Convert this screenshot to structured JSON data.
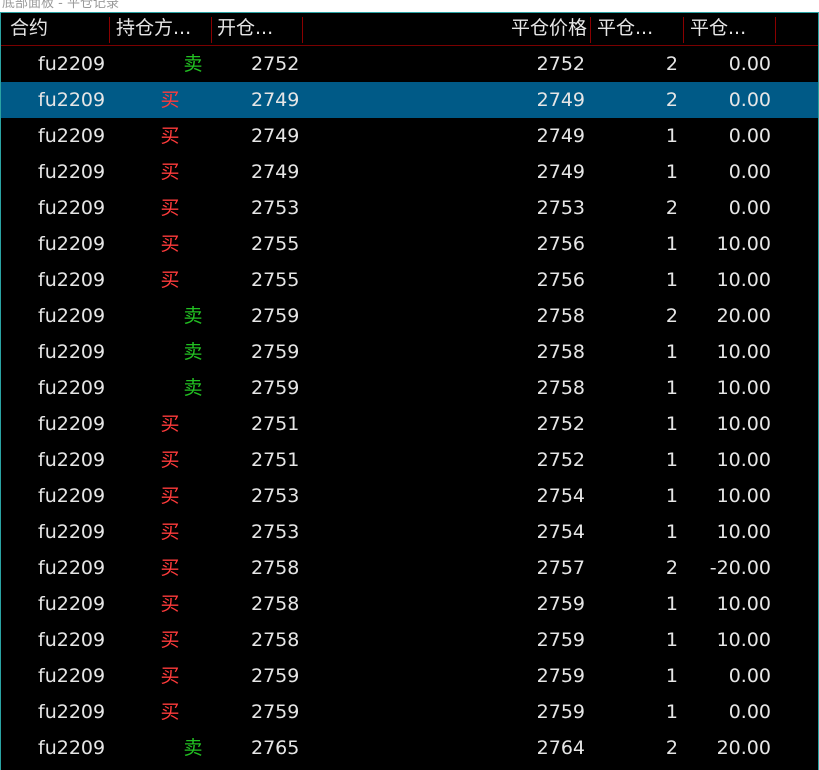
{
  "window_title": "底部面板 - 平仓记录",
  "columns": [
    {
      "key": "contract",
      "label": "合约"
    },
    {
      "key": "direction",
      "label": "持仓方..."
    },
    {
      "key": "open_price",
      "label": "开仓..."
    },
    {
      "key": "close_price",
      "label": "平仓价格"
    },
    {
      "key": "quantity",
      "label": "平仓..."
    },
    {
      "key": "pnl",
      "label": "平仓..."
    }
  ],
  "colors": {
    "buy": "#ff3b3b",
    "sell": "#22c022",
    "selected_row": "#005a87",
    "border": "#2aa3a3"
  },
  "selected_row_index": 1,
  "rows": [
    {
      "contract": "fu2209",
      "direction": "卖",
      "side": "sell",
      "open_price": "2752",
      "close_price": "2752",
      "quantity": "2",
      "pnl": "0.00"
    },
    {
      "contract": "fu2209",
      "direction": "买",
      "side": "buy",
      "open_price": "2749",
      "close_price": "2749",
      "quantity": "2",
      "pnl": "0.00"
    },
    {
      "contract": "fu2209",
      "direction": "买",
      "side": "buy",
      "open_price": "2749",
      "close_price": "2749",
      "quantity": "1",
      "pnl": "0.00"
    },
    {
      "contract": "fu2209",
      "direction": "买",
      "side": "buy",
      "open_price": "2749",
      "close_price": "2749",
      "quantity": "1",
      "pnl": "0.00"
    },
    {
      "contract": "fu2209",
      "direction": "买",
      "side": "buy",
      "open_price": "2753",
      "close_price": "2753",
      "quantity": "2",
      "pnl": "0.00"
    },
    {
      "contract": "fu2209",
      "direction": "买",
      "side": "buy",
      "open_price": "2755",
      "close_price": "2756",
      "quantity": "1",
      "pnl": "10.00"
    },
    {
      "contract": "fu2209",
      "direction": "买",
      "side": "buy",
      "open_price": "2755",
      "close_price": "2756",
      "quantity": "1",
      "pnl": "10.00"
    },
    {
      "contract": "fu2209",
      "direction": "卖",
      "side": "sell",
      "open_price": "2759",
      "close_price": "2758",
      "quantity": "2",
      "pnl": "20.00"
    },
    {
      "contract": "fu2209",
      "direction": "卖",
      "side": "sell",
      "open_price": "2759",
      "close_price": "2758",
      "quantity": "1",
      "pnl": "10.00"
    },
    {
      "contract": "fu2209",
      "direction": "卖",
      "side": "sell",
      "open_price": "2759",
      "close_price": "2758",
      "quantity": "1",
      "pnl": "10.00"
    },
    {
      "contract": "fu2209",
      "direction": "买",
      "side": "buy",
      "open_price": "2751",
      "close_price": "2752",
      "quantity": "1",
      "pnl": "10.00"
    },
    {
      "contract": "fu2209",
      "direction": "买",
      "side": "buy",
      "open_price": "2751",
      "close_price": "2752",
      "quantity": "1",
      "pnl": "10.00"
    },
    {
      "contract": "fu2209",
      "direction": "买",
      "side": "buy",
      "open_price": "2753",
      "close_price": "2754",
      "quantity": "1",
      "pnl": "10.00"
    },
    {
      "contract": "fu2209",
      "direction": "买",
      "side": "buy",
      "open_price": "2753",
      "close_price": "2754",
      "quantity": "1",
      "pnl": "10.00"
    },
    {
      "contract": "fu2209",
      "direction": "买",
      "side": "buy",
      "open_price": "2758",
      "close_price": "2757",
      "quantity": "2",
      "pnl": "-20.00"
    },
    {
      "contract": "fu2209",
      "direction": "买",
      "side": "buy",
      "open_price": "2758",
      "close_price": "2759",
      "quantity": "1",
      "pnl": "10.00"
    },
    {
      "contract": "fu2209",
      "direction": "买",
      "side": "buy",
      "open_price": "2758",
      "close_price": "2759",
      "quantity": "1",
      "pnl": "10.00"
    },
    {
      "contract": "fu2209",
      "direction": "买",
      "side": "buy",
      "open_price": "2759",
      "close_price": "2759",
      "quantity": "1",
      "pnl": "0.00"
    },
    {
      "contract": "fu2209",
      "direction": "买",
      "side": "buy",
      "open_price": "2759",
      "close_price": "2759",
      "quantity": "1",
      "pnl": "0.00"
    },
    {
      "contract": "fu2209",
      "direction": "卖",
      "side": "sell",
      "open_price": "2765",
      "close_price": "2764",
      "quantity": "2",
      "pnl": "20.00"
    }
  ]
}
